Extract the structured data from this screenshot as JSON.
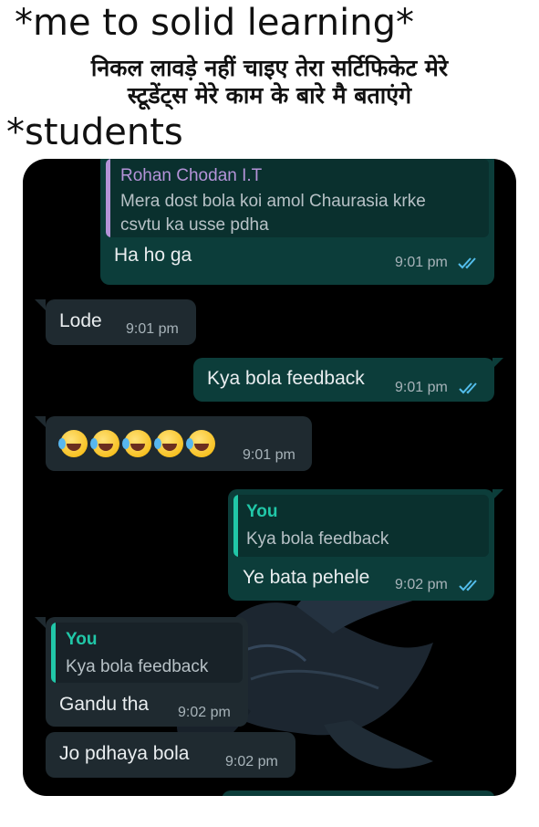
{
  "meme": {
    "caption_top": "*me to solid learning*",
    "caption_hindi": "निकल लावड़े नहीं  चाइए तेरा सर्टिफिकेट मेरे\nस्टूडेंट्स  मेरे काम के बारे मै बताएंगे",
    "caption_students": "*students"
  },
  "colors": {
    "outgoing_bubble": "#0c3d3a",
    "incoming_bubble": "#1f2a30",
    "quote_name_purple": "#b493d8",
    "quote_name_green": "#21c7a8",
    "read_ticks": "#53bdeb"
  },
  "chat": {
    "messages": [
      {
        "direction": "outgoing",
        "quote": {
          "name": "Rohan Chodan I.T",
          "text": "Mera dost bola koi amol Chaurasia krke csvtu ka usse pdha"
        },
        "text": "Ha ho ga",
        "time": "9:01 pm",
        "status": "read-double-tick"
      },
      {
        "direction": "incoming",
        "text": "Lode",
        "time": "9:01 pm"
      },
      {
        "direction": "outgoing",
        "text": "Kya bola feedback",
        "time": "9:01 pm",
        "status": "read-double-tick"
      },
      {
        "direction": "incoming",
        "emoji": "rolling-on-floor-laughing",
        "emoji_count": 5,
        "time": "9:01 pm"
      },
      {
        "direction": "outgoing",
        "quote": {
          "name": "You",
          "text": "Kya bola feedback"
        },
        "text": "Ye bata pehele",
        "time": "9:02 pm",
        "status": "read-double-tick"
      },
      {
        "direction": "incoming",
        "quote": {
          "name": "You",
          "text": "Kya bola feedback"
        },
        "text": "Gandu tha",
        "time": "9:02 pm"
      },
      {
        "direction": "incoming",
        "text": "Jo pdhaya bola",
        "time": "9:02 pm"
      }
    ]
  }
}
